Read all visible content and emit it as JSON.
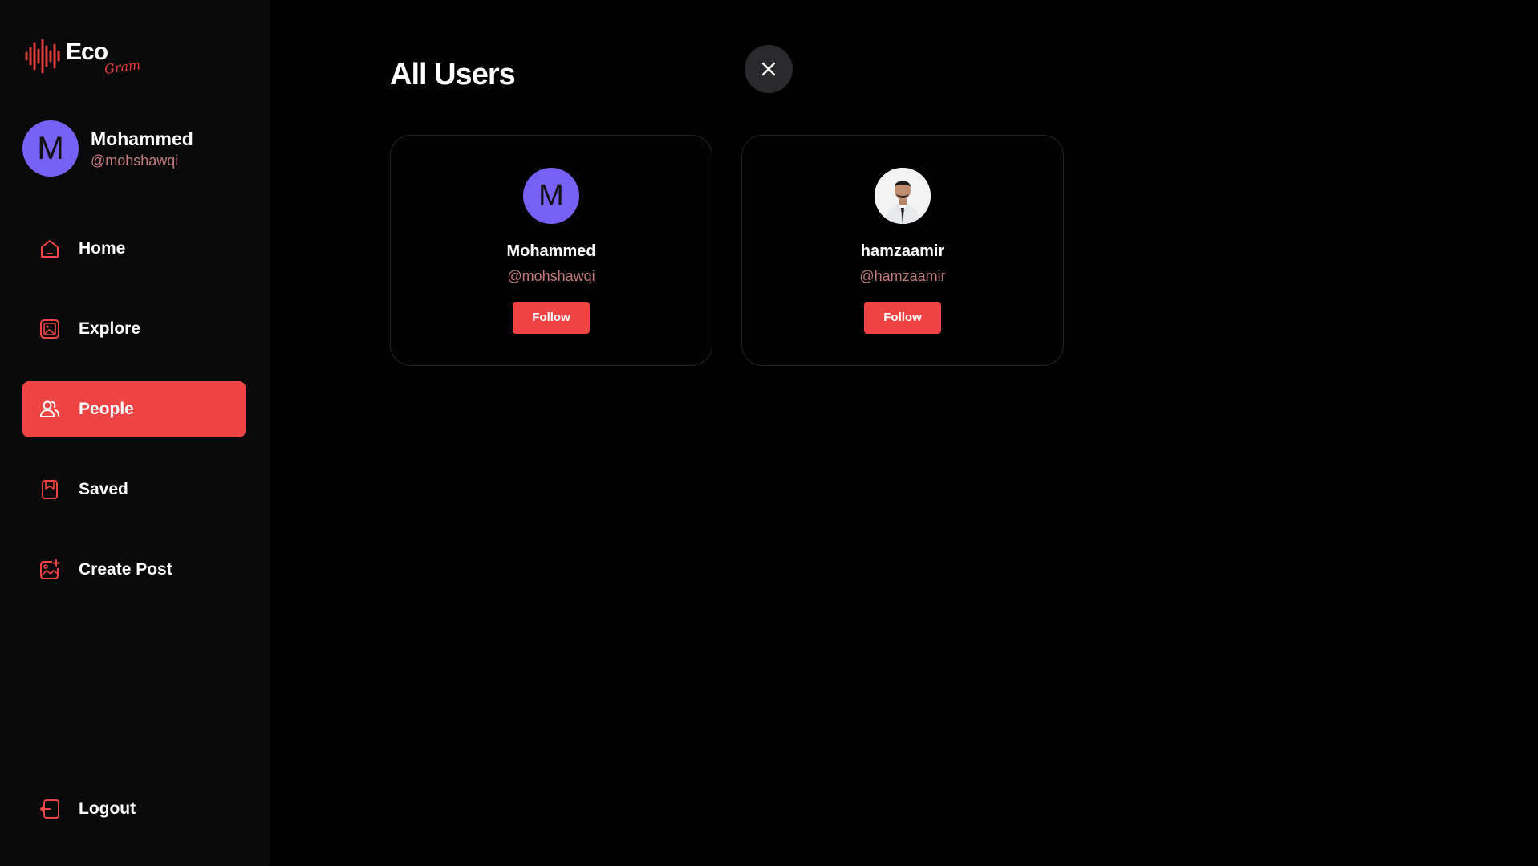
{
  "brand": {
    "name": "Eco",
    "script": "Gram",
    "accent": "#ee4444",
    "avatar_color": "#7761f5"
  },
  "profile": {
    "initial": "M",
    "name": "Mohammed",
    "handle": "@mohshawqi"
  },
  "sidebar": {
    "items": [
      {
        "label": "Home",
        "icon": "home-icon",
        "active": false
      },
      {
        "label": "Explore",
        "icon": "gallery-icon",
        "active": false
      },
      {
        "label": "People",
        "icon": "people-icon",
        "active": true
      },
      {
        "label": "Saved",
        "icon": "bookmark-icon",
        "active": false
      },
      {
        "label": "Create Post",
        "icon": "add-image-icon",
        "active": false
      }
    ],
    "logout_label": "Logout"
  },
  "main": {
    "title": "All Users",
    "users": [
      {
        "initial": "M",
        "name": "Mohammed",
        "handle": "@mohshawqi",
        "follow_label": "Follow",
        "avatar": "letter"
      },
      {
        "initial": "",
        "name": "hamzaamir",
        "handle": "@hamzaamir",
        "follow_label": "Follow",
        "avatar": "photo"
      }
    ]
  }
}
